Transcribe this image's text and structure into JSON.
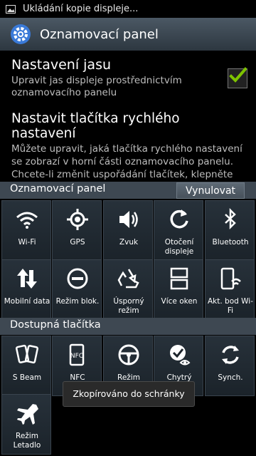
{
  "statusbar": {
    "notification_text": "Ukládání kopie displeje...",
    "icon": "image-icon"
  },
  "actionbar": {
    "title": "Oznamovací panel",
    "icon": "gear-icon"
  },
  "brightness_setting": {
    "title": "Nastavení jasu",
    "description": "Upravit jas displeje prostřednictvím oznamovacího panelu",
    "checked": true
  },
  "quick_settings_setting": {
    "title": "Nastavit tlačítka rychlého nastavení",
    "description": "Můžete upravit, jaká tlačítka rychlého nastavení se zobrazí v horní části oznamovacího panelu. Chcete-li změnit uspořádání tlačítek, klepněte na ně, přidržte je a přetáhněte"
  },
  "notification_panel_section": {
    "label": "Oznamovací panel",
    "reset_label": "Vynulovat"
  },
  "panel_tiles": [
    {
      "label": "Wi-Fi",
      "icon": "wifi-icon"
    },
    {
      "label": "GPS",
      "icon": "gps-icon"
    },
    {
      "label": "Zvuk",
      "icon": "sound-icon"
    },
    {
      "label": "Otočení displeje",
      "icon": "rotate-icon"
    },
    {
      "label": "Bluetooth",
      "icon": "bluetooth-icon"
    },
    {
      "label": "Mobilní data",
      "icon": "mobile-data-icon"
    },
    {
      "label": "Režim blok.",
      "icon": "block-icon"
    },
    {
      "label": "Úsporný režim",
      "icon": "recycle-icon"
    },
    {
      "label": "Více oken",
      "icon": "multi-window-icon"
    },
    {
      "label": "Akt. bod Wi-Fi",
      "icon": "hotspot-icon"
    }
  ],
  "available_section": {
    "label": "Dostupná tlačítka"
  },
  "available_tiles": [
    {
      "label": "S Beam",
      "icon": "s-beam-icon"
    },
    {
      "label": "NFC",
      "icon": "nfc-icon"
    },
    {
      "label": "Režim",
      "icon": "steering-wheel-icon"
    },
    {
      "label": "Chytrý",
      "icon": "smart-stay-icon"
    },
    {
      "label": "Synch.",
      "icon": "sync-icon"
    },
    {
      "label": "Režim Letadlo",
      "icon": "airplane-icon"
    }
  ],
  "toast": {
    "text": "Zkopírováno do schránky"
  },
  "colors": {
    "accent_check": "#7ec300",
    "section_bg": "#3e4852"
  }
}
